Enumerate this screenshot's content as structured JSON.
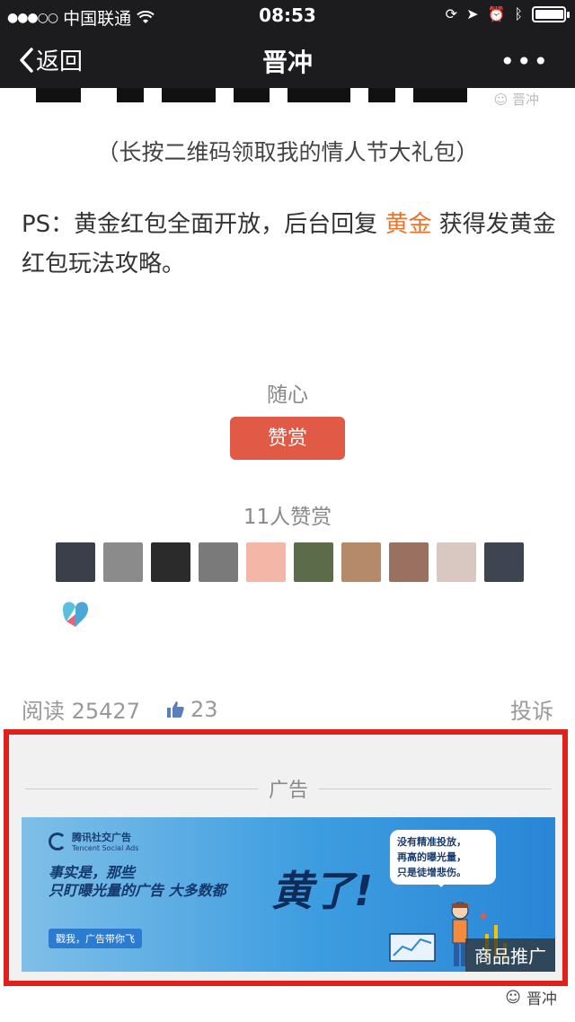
{
  "status_bar": {
    "signal": "●●●○○",
    "carrier": "中国联通",
    "time": "08:53"
  },
  "nav": {
    "back_label": "返回",
    "title": "晋冲",
    "more": "•••"
  },
  "watermark_top": "晋冲",
  "article": {
    "caption": "（长按二维码领取我的情人节大礼包）",
    "ps_prefix": "PS：黄金红包全面开放，后台回复 ",
    "ps_highlight": "黄金",
    "ps_suffix": " 获得发黄金红包玩法攻略。"
  },
  "reward": {
    "note": "随心",
    "button_label": "赞赏",
    "count_text": "11人赞赏",
    "avatars": [
      {
        "color": "#3a3f4a"
      },
      {
        "color": "#8b8b8b"
      },
      {
        "color": "#2b2b2b"
      },
      {
        "color": "#7a7a7a"
      },
      {
        "color": "#f4b6a6"
      },
      {
        "color": "#5c6b4a"
      },
      {
        "color": "#b58a6a"
      },
      {
        "color": "#9a7060"
      },
      {
        "color": "#d9c7c2"
      },
      {
        "color": "#3e4550"
      },
      {
        "color": "#ffffff"
      }
    ]
  },
  "meta": {
    "read_label": "阅读 25427",
    "likes": "23",
    "report_label": "投诉"
  },
  "ad": {
    "label": "广告",
    "brand_name": "腾讯社交广告",
    "brand_sub": "Tencent Social Ads",
    "headline_1": "事实是，那些",
    "headline_2": "只盯曝光量的广告 大多数都",
    "big_text": "黄了!",
    "tagline": "戳我，广告带你飞",
    "bubble_1": "没有精准投放，",
    "bubble_2": "再高的曝光量，",
    "bubble_3": "只是徒增悲伤。",
    "product_label": "商品推广"
  },
  "watermark_bottom": "晋冲",
  "colors": {
    "accent_orange": "#e87228",
    "reward_red": "#e05a45",
    "ad_frame_red": "#e0201a",
    "bar_dark": "#1c1c1e"
  }
}
